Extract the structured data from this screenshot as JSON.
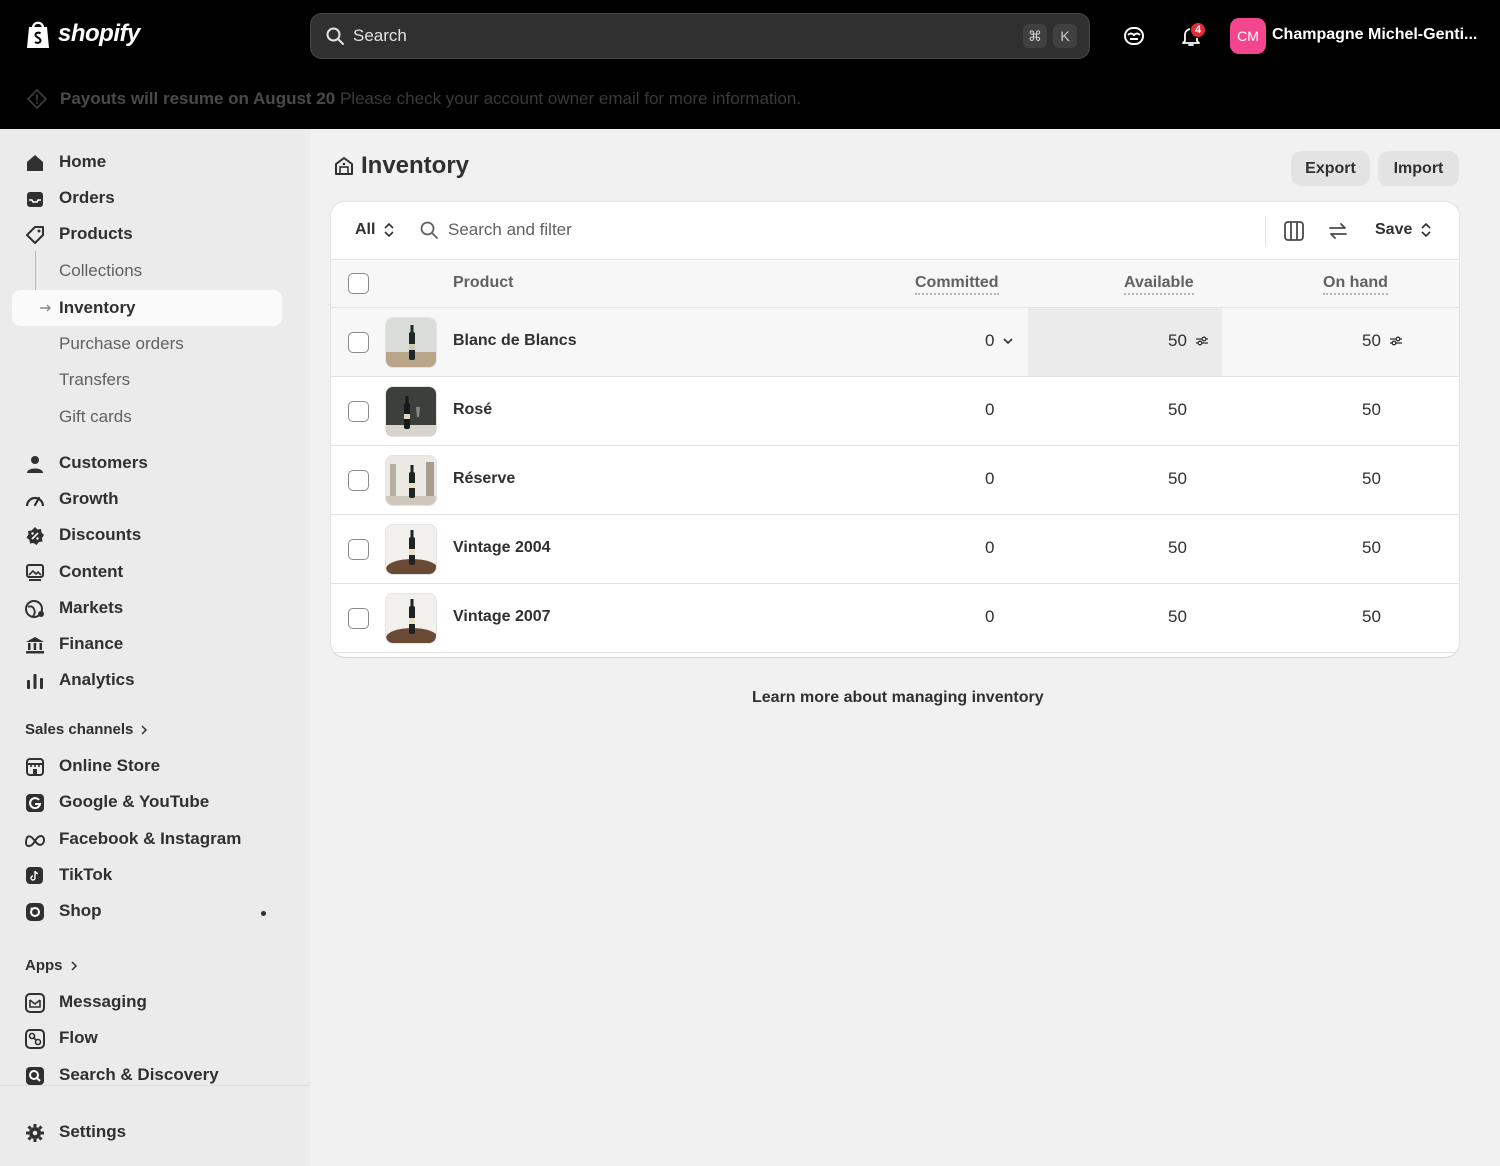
{
  "topbar": {
    "logo_text": "shopify",
    "search_placeholder": "Search",
    "shortcut_cmd": "⌘",
    "shortcut_key": "K",
    "notification_count": "4",
    "avatar_initials": "CM",
    "store_name": "Champagne Michel-Genti..."
  },
  "banner": {
    "bold_text": "Payouts will resume on August 20",
    "text": "Please check your account owner email for more information."
  },
  "sidebar": {
    "main_items": [
      "Home",
      "Orders",
      "Products"
    ],
    "product_subitems": [
      "Collections",
      "Inventory",
      "Purchase orders",
      "Transfers",
      "Gift cards"
    ],
    "more_items": [
      "Customers",
      "Growth",
      "Discounts",
      "Content",
      "Markets",
      "Finance",
      "Analytics"
    ],
    "sales_channels_heading": "Sales channels",
    "sales_channels": [
      "Online Store",
      "Google & YouTube",
      "Facebook & Instagram",
      "TikTok",
      "Shop"
    ],
    "apps_heading": "Apps",
    "apps": [
      "Messaging",
      "Flow",
      "Search & Discovery"
    ],
    "settings": "Settings"
  },
  "page": {
    "title": "Inventory",
    "export_label": "Export",
    "import_label": "Import",
    "filter_all": "All",
    "search_filter_placeholder": "Search and filter",
    "save_label": "Save",
    "footer_link": "Learn more about managing inventory"
  },
  "table": {
    "columns": [
      "Product",
      "Committed",
      "Available",
      "On hand"
    ],
    "rows": [
      {
        "product": "Blanc de Blancs",
        "committed": "0",
        "available": "50",
        "on_hand": "50"
      },
      {
        "product": "Rosé",
        "committed": "0",
        "available": "50",
        "on_hand": "50"
      },
      {
        "product": "Réserve",
        "committed": "0",
        "available": "50",
        "on_hand": "50"
      },
      {
        "product": "Vintage 2004",
        "committed": "0",
        "available": "50",
        "on_hand": "50"
      },
      {
        "product": "Vintage 2007",
        "committed": "0",
        "available": "50",
        "on_hand": "50"
      }
    ]
  },
  "colors": {
    "topbar_bg": "#000000",
    "avatar_bg": "#f4468f",
    "badge_bg": "#e22c38",
    "page_bg": "#f1f1f1"
  }
}
